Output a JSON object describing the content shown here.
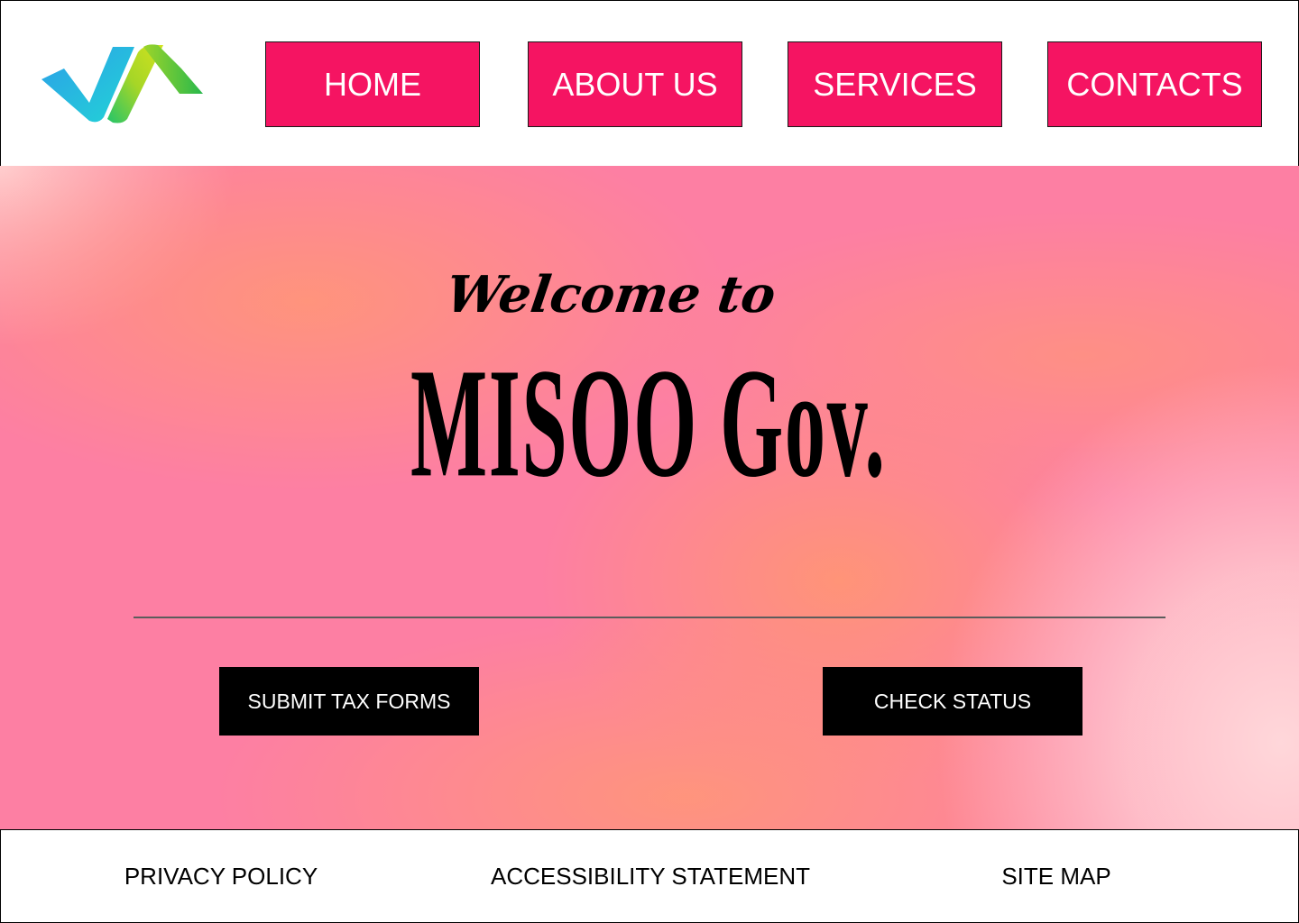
{
  "header": {
    "nav": [
      {
        "label": "HOME"
      },
      {
        "label": "ABOUT US"
      },
      {
        "label": "SERVICES"
      },
      {
        "label": "CONTACTS"
      }
    ]
  },
  "hero": {
    "welcome": "Welcome to",
    "title": "MISOO Gov.",
    "buttons": [
      {
        "label": "SUBMIT TAX FORMS"
      },
      {
        "label": "CHECK STATUS"
      }
    ]
  },
  "footer": {
    "links": [
      {
        "label": "PRIVACY POLICY"
      },
      {
        "label": "ACCESSIBILITY STATEMENT"
      },
      {
        "label": "SITE MAP"
      }
    ]
  },
  "colors": {
    "nav_button": "#f51462",
    "action_button": "#000000",
    "hero_pink": "#fd7fa3",
    "hero_orange": "#ff9676",
    "logo_blue": "#1fb5e6",
    "logo_green": "#8fd12b"
  }
}
